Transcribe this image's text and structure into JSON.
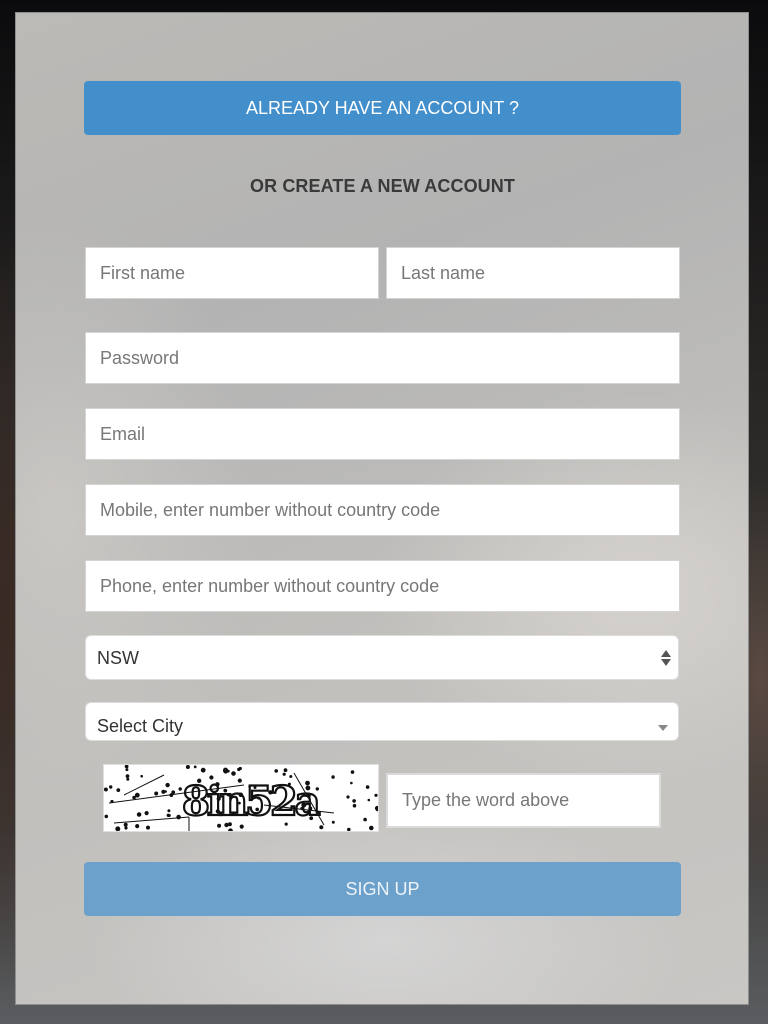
{
  "form": {
    "login_button_label": "ALREADY HAVE AN ACCOUNT ?",
    "subheading": "OR CREATE A NEW ACCOUNT",
    "fields": {
      "first_name": {
        "placeholder": "First name",
        "value": ""
      },
      "last_name": {
        "placeholder": "Last name",
        "value": ""
      },
      "password": {
        "placeholder": "Password",
        "value": ""
      },
      "email": {
        "placeholder": "Email",
        "value": ""
      },
      "mobile": {
        "placeholder": "Mobile, enter number without country code",
        "value": ""
      },
      "phone": {
        "placeholder": "Phone, enter number without country code",
        "value": ""
      }
    },
    "state_select": {
      "selected": "NSW",
      "icon": "updown-arrows-icon"
    },
    "city_select": {
      "selected": "Select City",
      "icon": "caret-down-icon"
    },
    "captcha": {
      "image_text": "8in52a",
      "input_placeholder": "Type the word above",
      "input_value": ""
    },
    "signup_button_label": "SIGN UP"
  },
  "colors": {
    "primary_button": "#438fcb",
    "signup_button": "#6ca1cb",
    "subheading_text": "#3a3a3a",
    "placeholder_text": "#777777"
  }
}
